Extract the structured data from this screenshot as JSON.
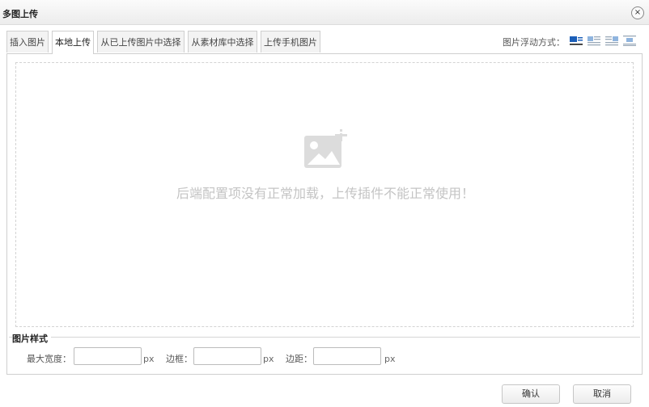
{
  "dialog": {
    "title": "多图上传",
    "close_label": "×"
  },
  "tabs": [
    {
      "label": "插入图片",
      "active": false
    },
    {
      "label": "本地上传",
      "active": true
    },
    {
      "label": "从已上传图片中选择",
      "active": false
    },
    {
      "label": "从素材库中选择",
      "active": false
    },
    {
      "label": "上传手机图片",
      "active": false
    }
  ],
  "float_mode": {
    "label": "图片浮动方式：",
    "options": [
      "none-icon",
      "left-icon",
      "right-icon",
      "center-icon"
    ],
    "selected": "none-icon"
  },
  "drop_area": {
    "icon": "image-add-icon",
    "message": "后端配置项没有正常加载，上传插件不能正常使用！"
  },
  "image_style": {
    "legend": "图片样式",
    "max_width_label": "最大宽度：",
    "max_width_value": "",
    "max_width_unit": "px",
    "border_label": "边框：",
    "border_value": "",
    "border_unit": "px",
    "margin_label": "边距：",
    "margin_value": "",
    "margin_unit": "px"
  },
  "buttons": {
    "confirm": "确认",
    "cancel": "取消"
  },
  "colors": {
    "accent": "#2a6fc9",
    "placeholder_text": "#c4c4c4",
    "border": "#cfcfcf"
  }
}
